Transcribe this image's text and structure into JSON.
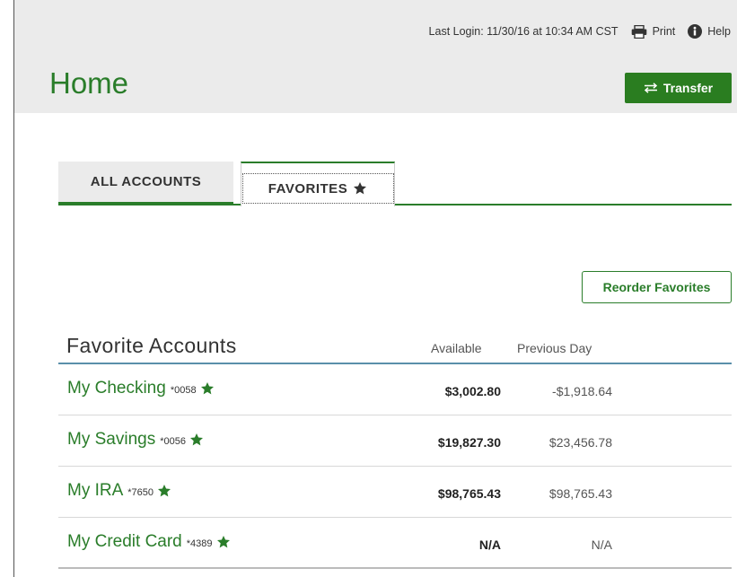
{
  "header": {
    "last_login": "Last Login: 11/30/16 at 10:34 AM CST",
    "print_label": "Print",
    "help_label": "Help",
    "page_title": "Home",
    "transfer_label": "Transfer"
  },
  "tabs": {
    "all_accounts": "ALL ACCOUNTS",
    "favorites": "FAVORITES"
  },
  "reorder_label": "Reorder Favorites",
  "section": {
    "title": "Favorite Accounts",
    "col_available": "Available",
    "col_previous": "Previous Day"
  },
  "accounts": [
    {
      "name": "My Checking",
      "number": "*0058",
      "available": "$3,002.80",
      "previous": "-$1,918.64"
    },
    {
      "name": "My Savings",
      "number": "*0056",
      "available": "$19,827.30",
      "previous": "$23,456.78"
    },
    {
      "name": "My IRA",
      "number": "*7650",
      "available": "$98,765.43",
      "previous": "$98,765.43"
    },
    {
      "name": "My Credit Card",
      "number": "*4389",
      "available": "N/A",
      "previous": "N/A"
    }
  ],
  "colors": {
    "brand_green": "#2a7d2a",
    "header_bg": "#ebebeb",
    "rule_blue": "#5a8faa"
  },
  "icons": [
    "printer-icon",
    "info-icon",
    "transfer-arrows-icon",
    "star-icon"
  ]
}
